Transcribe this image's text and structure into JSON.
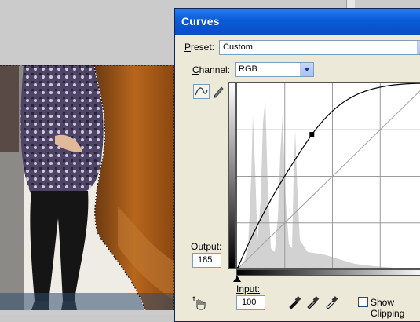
{
  "dialog": {
    "title": "Curves",
    "preset": {
      "label_prefix": "P",
      "label_rest": "reset:",
      "value": "Custom"
    },
    "channel": {
      "label_prefix": "C",
      "label_rest": "hannel:",
      "value": "RGB"
    },
    "output": {
      "label": "Output:",
      "value": "185"
    },
    "input": {
      "label": "Input:",
      "value": "100"
    },
    "show_clipping": {
      "label": "Show Clipping",
      "checked": false
    }
  },
  "icons": {
    "curve_tool": "curve-point-icon",
    "pencil_tool": "pencil-icon",
    "hand_tool": "hand-adjust-icon",
    "black_eyedropper": "eyedropper-black-icon",
    "gray_eyedropper": "eyedropper-gray-icon",
    "white_eyedropper": "eyedropper-white-icon"
  },
  "curve": {
    "points": [
      [
        0,
        0
      ],
      [
        100,
        185
      ],
      [
        255,
        255
      ]
    ]
  },
  "colors": {
    "titlebar": "#0a5bd8",
    "dialog_bg": "#ece9d8"
  }
}
